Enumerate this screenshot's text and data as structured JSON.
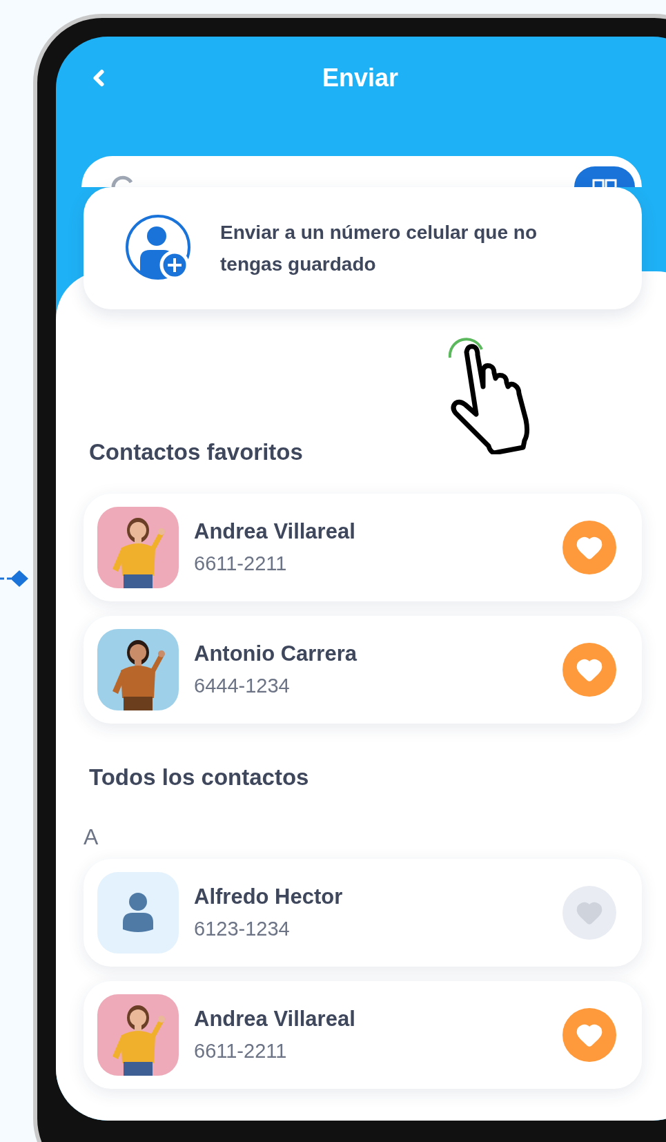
{
  "header": {
    "title": "Enviar"
  },
  "new_number_card": {
    "text": "Enviar a un número celular que no tengas guardado"
  },
  "sections": [
    {
      "title": "Contactos favoritos",
      "contacts": [
        {
          "name": "Andrea Villareal",
          "phone": "6611-2211",
          "kind": "picture",
          "favorite": true
        },
        {
          "name": "Antonio Carrera",
          "phone": "6444-1234",
          "kind": "picture",
          "favorite": true
        }
      ]
    },
    {
      "title": "Todos los contactos",
      "letter": "A",
      "contacts": [
        {
          "name": "Alfredo Hector",
          "phone": "6123-1234",
          "kind": "placeholder",
          "favorite": false
        },
        {
          "name": "Andrea Villareal",
          "phone": "6611-2211",
          "kind": "picture",
          "favorite": true
        }
      ]
    }
  ]
}
